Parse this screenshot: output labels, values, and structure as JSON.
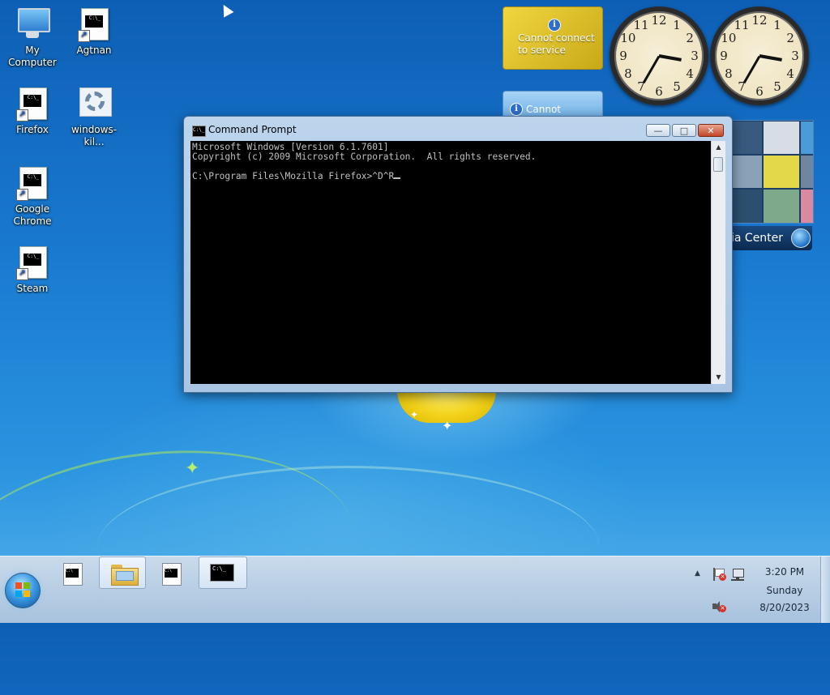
{
  "desktop_icons": [
    {
      "label": "My Computer",
      "icon": "computer-icon"
    },
    {
      "label": "Agtnan",
      "icon": "shortcut-terminal-icon"
    },
    {
      "label": "Firefox",
      "icon": "shortcut-terminal-icon"
    },
    {
      "label": "windows-kil...",
      "icon": "settings-gear-icon"
    },
    {
      "label": "Google Chrome",
      "icon": "shortcut-terminal-icon"
    },
    {
      "label": "Steam",
      "icon": "shortcut-terminal-icon"
    }
  ],
  "gadgets": {
    "weather_status": "Cannot connect to service",
    "weather_status_line1": "Cannot connect",
    "weather_status_line2": "to service",
    "feed_status": "Cannot connect",
    "media_center_label": "ia Center",
    "clock_numbers": [
      "12",
      "1",
      "2",
      "3",
      "4",
      "5",
      "6",
      "7",
      "8",
      "9",
      "10",
      "11"
    ]
  },
  "cmd_window": {
    "title": "Command Prompt",
    "icon_text": "C:\\_",
    "line1": "Microsoft Windows [Version 6.1.7601]",
    "line2": "Copyright (c) 2009 Microsoft Corporation.  All rights reserved.",
    "line3": "",
    "prompt": "C:\\Program Files\\Mozilla Firefox>^D^R",
    "minimize": "—",
    "maximize": "□",
    "close": "✕"
  },
  "taskbar": {
    "items": [
      {
        "name": "cmd-shortcut",
        "icon": "terminal-icon",
        "active": false
      },
      {
        "name": "windows-explorer",
        "icon": "folder-icon",
        "active": true
      },
      {
        "name": "cmd-shortcut-2",
        "icon": "terminal-icon",
        "active": false
      },
      {
        "name": "command-prompt",
        "icon": "terminal-icon",
        "active": true
      }
    ],
    "tray": {
      "show_hidden": "▲",
      "time": "3:20 PM",
      "day": "Sunday",
      "date": "8/20/2023"
    }
  },
  "colors": {
    "console_bg": "#000000",
    "console_fg": "#c0c0c0",
    "taskbar": "#b9cfe5"
  }
}
